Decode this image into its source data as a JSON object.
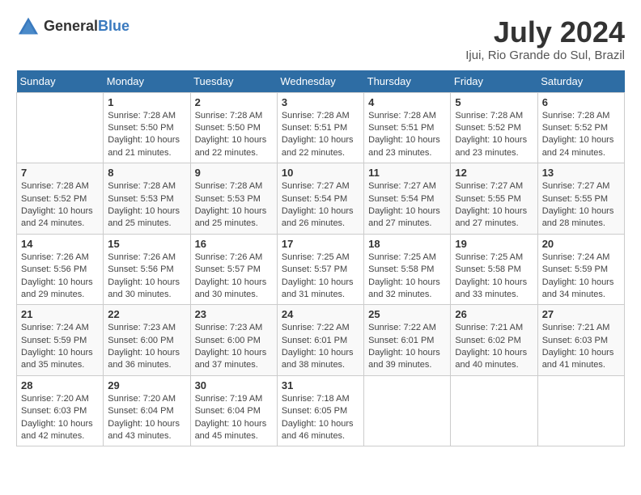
{
  "header": {
    "logo_general": "General",
    "logo_blue": "Blue",
    "title": "July 2024",
    "subtitle": "Ijui, Rio Grande do Sul, Brazil"
  },
  "calendar": {
    "days_of_week": [
      "Sunday",
      "Monday",
      "Tuesday",
      "Wednesday",
      "Thursday",
      "Friday",
      "Saturday"
    ],
    "weeks": [
      [
        {
          "day": "",
          "sunrise": "",
          "sunset": "",
          "daylight": ""
        },
        {
          "day": "1",
          "sunrise": "Sunrise: 7:28 AM",
          "sunset": "Sunset: 5:50 PM",
          "daylight": "Daylight: 10 hours and 21 minutes."
        },
        {
          "day": "2",
          "sunrise": "Sunrise: 7:28 AM",
          "sunset": "Sunset: 5:50 PM",
          "daylight": "Daylight: 10 hours and 22 minutes."
        },
        {
          "day": "3",
          "sunrise": "Sunrise: 7:28 AM",
          "sunset": "Sunset: 5:51 PM",
          "daylight": "Daylight: 10 hours and 22 minutes."
        },
        {
          "day": "4",
          "sunrise": "Sunrise: 7:28 AM",
          "sunset": "Sunset: 5:51 PM",
          "daylight": "Daylight: 10 hours and 23 minutes."
        },
        {
          "day": "5",
          "sunrise": "Sunrise: 7:28 AM",
          "sunset": "Sunset: 5:52 PM",
          "daylight": "Daylight: 10 hours and 23 minutes."
        },
        {
          "day": "6",
          "sunrise": "Sunrise: 7:28 AM",
          "sunset": "Sunset: 5:52 PM",
          "daylight": "Daylight: 10 hours and 24 minutes."
        }
      ],
      [
        {
          "day": "7",
          "sunrise": "Sunrise: 7:28 AM",
          "sunset": "Sunset: 5:52 PM",
          "daylight": "Daylight: 10 hours and 24 minutes."
        },
        {
          "day": "8",
          "sunrise": "Sunrise: 7:28 AM",
          "sunset": "Sunset: 5:53 PM",
          "daylight": "Daylight: 10 hours and 25 minutes."
        },
        {
          "day": "9",
          "sunrise": "Sunrise: 7:28 AM",
          "sunset": "Sunset: 5:53 PM",
          "daylight": "Daylight: 10 hours and 25 minutes."
        },
        {
          "day": "10",
          "sunrise": "Sunrise: 7:27 AM",
          "sunset": "Sunset: 5:54 PM",
          "daylight": "Daylight: 10 hours and 26 minutes."
        },
        {
          "day": "11",
          "sunrise": "Sunrise: 7:27 AM",
          "sunset": "Sunset: 5:54 PM",
          "daylight": "Daylight: 10 hours and 27 minutes."
        },
        {
          "day": "12",
          "sunrise": "Sunrise: 7:27 AM",
          "sunset": "Sunset: 5:55 PM",
          "daylight": "Daylight: 10 hours and 27 minutes."
        },
        {
          "day": "13",
          "sunrise": "Sunrise: 7:27 AM",
          "sunset": "Sunset: 5:55 PM",
          "daylight": "Daylight: 10 hours and 28 minutes."
        }
      ],
      [
        {
          "day": "14",
          "sunrise": "Sunrise: 7:26 AM",
          "sunset": "Sunset: 5:56 PM",
          "daylight": "Daylight: 10 hours and 29 minutes."
        },
        {
          "day": "15",
          "sunrise": "Sunrise: 7:26 AM",
          "sunset": "Sunset: 5:56 PM",
          "daylight": "Daylight: 10 hours and 30 minutes."
        },
        {
          "day": "16",
          "sunrise": "Sunrise: 7:26 AM",
          "sunset": "Sunset: 5:57 PM",
          "daylight": "Daylight: 10 hours and 30 minutes."
        },
        {
          "day": "17",
          "sunrise": "Sunrise: 7:25 AM",
          "sunset": "Sunset: 5:57 PM",
          "daylight": "Daylight: 10 hours and 31 minutes."
        },
        {
          "day": "18",
          "sunrise": "Sunrise: 7:25 AM",
          "sunset": "Sunset: 5:58 PM",
          "daylight": "Daylight: 10 hours and 32 minutes."
        },
        {
          "day": "19",
          "sunrise": "Sunrise: 7:25 AM",
          "sunset": "Sunset: 5:58 PM",
          "daylight": "Daylight: 10 hours and 33 minutes."
        },
        {
          "day": "20",
          "sunrise": "Sunrise: 7:24 AM",
          "sunset": "Sunset: 5:59 PM",
          "daylight": "Daylight: 10 hours and 34 minutes."
        }
      ],
      [
        {
          "day": "21",
          "sunrise": "Sunrise: 7:24 AM",
          "sunset": "Sunset: 5:59 PM",
          "daylight": "Daylight: 10 hours and 35 minutes."
        },
        {
          "day": "22",
          "sunrise": "Sunrise: 7:23 AM",
          "sunset": "Sunset: 6:00 PM",
          "daylight": "Daylight: 10 hours and 36 minutes."
        },
        {
          "day": "23",
          "sunrise": "Sunrise: 7:23 AM",
          "sunset": "Sunset: 6:00 PM",
          "daylight": "Daylight: 10 hours and 37 minutes."
        },
        {
          "day": "24",
          "sunrise": "Sunrise: 7:22 AM",
          "sunset": "Sunset: 6:01 PM",
          "daylight": "Daylight: 10 hours and 38 minutes."
        },
        {
          "day": "25",
          "sunrise": "Sunrise: 7:22 AM",
          "sunset": "Sunset: 6:01 PM",
          "daylight": "Daylight: 10 hours and 39 minutes."
        },
        {
          "day": "26",
          "sunrise": "Sunrise: 7:21 AM",
          "sunset": "Sunset: 6:02 PM",
          "daylight": "Daylight: 10 hours and 40 minutes."
        },
        {
          "day": "27",
          "sunrise": "Sunrise: 7:21 AM",
          "sunset": "Sunset: 6:03 PM",
          "daylight": "Daylight: 10 hours and 41 minutes."
        }
      ],
      [
        {
          "day": "28",
          "sunrise": "Sunrise: 7:20 AM",
          "sunset": "Sunset: 6:03 PM",
          "daylight": "Daylight: 10 hours and 42 minutes."
        },
        {
          "day": "29",
          "sunrise": "Sunrise: 7:20 AM",
          "sunset": "Sunset: 6:04 PM",
          "daylight": "Daylight: 10 hours and 43 minutes."
        },
        {
          "day": "30",
          "sunrise": "Sunrise: 7:19 AM",
          "sunset": "Sunset: 6:04 PM",
          "daylight": "Daylight: 10 hours and 45 minutes."
        },
        {
          "day": "31",
          "sunrise": "Sunrise: 7:18 AM",
          "sunset": "Sunset: 6:05 PM",
          "daylight": "Daylight: 10 hours and 46 minutes."
        },
        {
          "day": "",
          "sunrise": "",
          "sunset": "",
          "daylight": ""
        },
        {
          "day": "",
          "sunrise": "",
          "sunset": "",
          "daylight": ""
        },
        {
          "day": "",
          "sunrise": "",
          "sunset": "",
          "daylight": ""
        }
      ]
    ]
  }
}
